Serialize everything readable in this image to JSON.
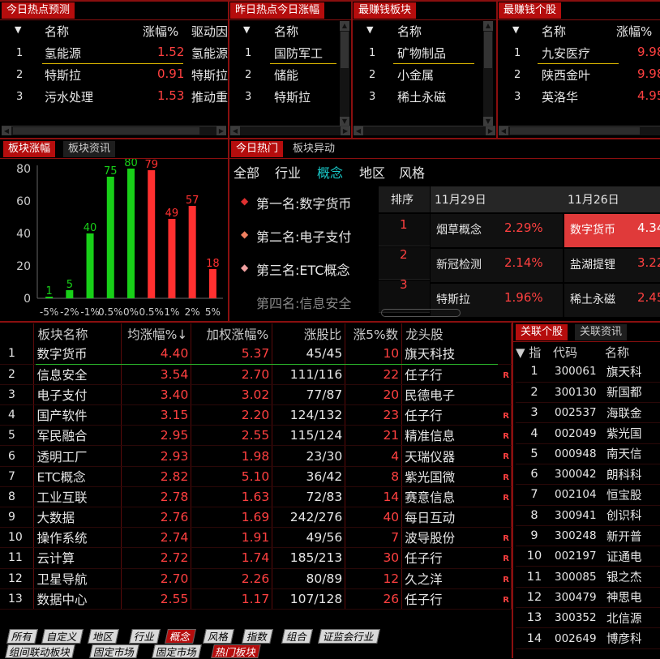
{
  "top_panels": [
    {
      "title": "今日热点预测",
      "headers": [
        "名称",
        "涨幅%",
        "驱动因"
      ],
      "rows": [
        [
          "1",
          "氢能源",
          "1.52",
          "氢能源"
        ],
        [
          "2",
          "特斯拉",
          "0.91",
          "特斯拉"
        ],
        [
          "3",
          "污水处理",
          "1.53",
          "推动重"
        ]
      ]
    },
    {
      "title": "昨日热点今日涨幅",
      "headers": [
        "名称"
      ],
      "rows": [
        [
          "1",
          "国防军工"
        ],
        [
          "2",
          "储能"
        ],
        [
          "3",
          "特斯拉"
        ]
      ]
    },
    {
      "title": "最赚钱板块",
      "headers": [
        "名称"
      ],
      "rows": [
        [
          "1",
          "矿物制品"
        ],
        [
          "2",
          "小金属"
        ],
        [
          "3",
          "稀土永磁"
        ]
      ]
    },
    {
      "title": "最赚钱个股",
      "headers": [
        "名称",
        "涨幅%"
      ],
      "rows": [
        [
          "1",
          "九安医疗",
          "9.98"
        ],
        [
          "2",
          "陕西金叶",
          "9.98"
        ],
        [
          "3",
          "英洛华",
          "4.95"
        ]
      ]
    }
  ],
  "sort_arrow": "▼",
  "chart_tabs": [
    "板块涨幅",
    "板块资讯"
  ],
  "chart_data": {
    "type": "bar",
    "categories": [
      "-5%",
      "-2%",
      "-1%",
      "0.5%",
      "0%",
      "0.5%",
      "1%",
      "2%",
      "5%"
    ],
    "values": [
      1,
      5,
      40,
      75,
      80,
      79,
      49,
      57,
      18
    ],
    "colors": [
      "#18d018",
      "#18d018",
      "#18d018",
      "#18d018",
      "#18d018",
      "#ff3030",
      "#ff3030",
      "#ff3030",
      "#ff3030"
    ],
    "y_ticks": [
      "80",
      "60",
      "40",
      "20",
      "0"
    ],
    "ylim": [
      0,
      80
    ]
  },
  "hot": {
    "tabs": [
      "今日热门",
      "板块异动"
    ],
    "sub_tabs": [
      "全部",
      "行业",
      "概念",
      "地区",
      "风格"
    ],
    "ranks": [
      "第一名:数字货币",
      "第二名:电子支付",
      "第三名:ETC概念",
      "第四名:信息安全"
    ],
    "rank_header": "排序",
    "rank_nums": [
      "1",
      "2",
      "3"
    ],
    "dates": [
      "11月29日",
      "11月26日"
    ],
    "col1": [
      [
        "烟草概念",
        "2.29%"
      ],
      [
        "新冠检测",
        "2.14%"
      ],
      [
        "特斯拉",
        "1.96%"
      ]
    ],
    "col2": [
      [
        "数字货币",
        "4.34"
      ],
      [
        "盐湖提锂",
        "3.22"
      ],
      [
        "稀土永磁",
        "2.45"
      ]
    ]
  },
  "main_table": {
    "headers": [
      "",
      "板块名称",
      "均涨幅%↓",
      "加权涨幅%",
      "涨股比",
      "涨5%数",
      "龙头股"
    ],
    "rows": [
      [
        "1",
        "数字货币",
        "4.40",
        "5.37",
        "45/45",
        "10",
        "旗天科技",
        ""
      ],
      [
        "2",
        "信息安全",
        "3.54",
        "2.70",
        "111/116",
        "22",
        "任子行",
        "R"
      ],
      [
        "3",
        "电子支付",
        "3.40",
        "3.02",
        "77/87",
        "20",
        "民德电子",
        ""
      ],
      [
        "4",
        "国产软件",
        "3.15",
        "2.20",
        "124/132",
        "23",
        "任子行",
        "R"
      ],
      [
        "5",
        "军民融合",
        "2.95",
        "2.55",
        "115/124",
        "21",
        "精准信息",
        "R"
      ],
      [
        "6",
        "透明工厂",
        "2.93",
        "1.98",
        "23/30",
        "4",
        "天瑞仪器",
        "R"
      ],
      [
        "7",
        "ETC概念",
        "2.82",
        "5.10",
        "36/42",
        "8",
        "紫光国微",
        "R"
      ],
      [
        "8",
        "工业互联",
        "2.78",
        "1.63",
        "72/83",
        "14",
        "赛意信息",
        "R"
      ],
      [
        "9",
        "大数据",
        "2.76",
        "1.69",
        "242/276",
        "40",
        "每日互动",
        ""
      ],
      [
        "10",
        "操作系统",
        "2.74",
        "1.91",
        "49/56",
        "7",
        "波导股份",
        "R"
      ],
      [
        "11",
        "云计算",
        "2.72",
        "1.74",
        "185/213",
        "30",
        "任子行",
        "R"
      ],
      [
        "12",
        "卫星导航",
        "2.70",
        "2.26",
        "80/89",
        "12",
        "久之洋",
        "R"
      ],
      [
        "13",
        "数据中心",
        "2.55",
        "1.17",
        "107/128",
        "26",
        "任子行",
        "R"
      ]
    ]
  },
  "related": {
    "tabs": [
      "关联个股",
      "关联资讯"
    ],
    "headers": [
      "▼ 指",
      "代码",
      "名称"
    ],
    "rows": [
      [
        "1",
        "300061",
        "旗天科"
      ],
      [
        "2",
        "300130",
        "新国都"
      ],
      [
        "3",
        "002537",
        "海联金"
      ],
      [
        "4",
        "002049",
        "紫光国"
      ],
      [
        "5",
        "000948",
        "南天信"
      ],
      [
        "6",
        "300042",
        "朗科科"
      ],
      [
        "7",
        "002104",
        "恒宝股"
      ],
      [
        "8",
        "300941",
        "创识科"
      ],
      [
        "9",
        "300248",
        "新开普"
      ],
      [
        "10",
        "002197",
        "证通电"
      ],
      [
        "11",
        "300085",
        "银之杰"
      ],
      [
        "12",
        "300479",
        "神思电"
      ],
      [
        "13",
        "300352",
        "北信源"
      ],
      [
        "14",
        "002649",
        "博彦科"
      ]
    ]
  },
  "bottom_tabs": [
    "所有",
    "自定义",
    "地区",
    "行业",
    "概念",
    "风格",
    "指数",
    "组合",
    "证监会行业"
  ],
  "bottom_active": "概念",
  "bottom_tabs2": [
    "组间联动板块",
    "固定市场",
    "固定市场",
    "热门板块"
  ],
  "bottom_active2": "热门板块",
  "colors": {
    "accent": "#b50d0d",
    "up": "#ff4040",
    "down": "#18d018",
    "active": "#19c8c8"
  }
}
